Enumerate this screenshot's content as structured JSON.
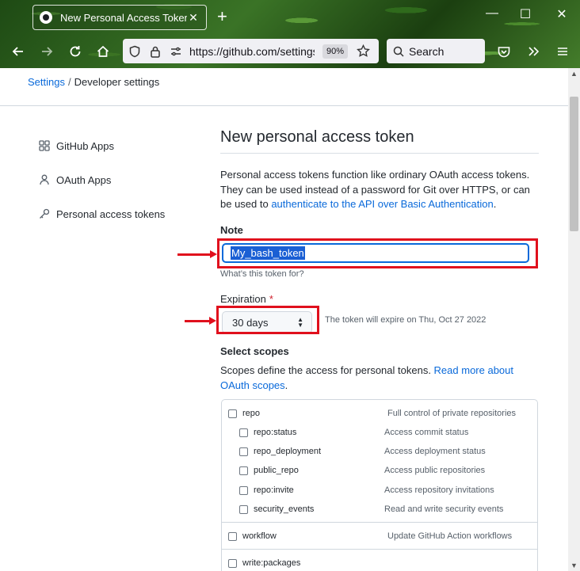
{
  "browser": {
    "tab_title": "New Personal Access Token",
    "url": "https://github.com/settings/tokens/new",
    "zoom": "90%",
    "search_placeholder": "Search"
  },
  "breadcrumb": {
    "settings": "Settings",
    "separator": "/",
    "current": "Developer settings"
  },
  "sidebar": {
    "items": [
      {
        "label": "GitHub Apps",
        "icon": "apps-grid-icon"
      },
      {
        "label": "OAuth Apps",
        "icon": "person-icon"
      },
      {
        "label": "Personal access tokens",
        "icon": "key-icon"
      }
    ]
  },
  "main": {
    "title": "New personal access token",
    "description_before": "Personal access tokens function like ordinary OAuth access tokens. They can be used instead of a password for Git over HTTPS, or can be used to ",
    "description_link": "authenticate to the API over Basic Authentication",
    "description_after": ".",
    "note_label": "Note",
    "note_value": "My_bash_token",
    "note_hint": "What’s this token for?",
    "expiration_label": "Expiration",
    "expiration_required": "*",
    "expiration_value": "30 days",
    "expiration_note": "The token will expire on Thu, Oct 27 2022",
    "scopes_title": "Select scopes",
    "scopes_desc_before": "Scopes define the access for personal tokens. ",
    "scopes_desc_link": "Read more about OAuth scopes",
    "scopes_desc_after": "."
  },
  "scopes": {
    "repo": {
      "name": "repo",
      "desc": "Full control of private repositories"
    },
    "repo_children": [
      {
        "name": "repo:status",
        "desc": "Access commit status"
      },
      {
        "name": "repo_deployment",
        "desc": "Access deployment status"
      },
      {
        "name": "public_repo",
        "desc": "Access public repositories"
      },
      {
        "name": "repo:invite",
        "desc": "Access repository invitations"
      },
      {
        "name": "security_events",
        "desc": "Read and write security events"
      }
    ],
    "workflow": {
      "name": "workflow",
      "desc": "Update GitHub Action workflows"
    },
    "write_packages": {
      "name": "write:packages",
      "desc": ""
    }
  },
  "colors": {
    "link": "#0969da",
    "annotation_red": "#e0101d",
    "required": "#cf222e"
  }
}
